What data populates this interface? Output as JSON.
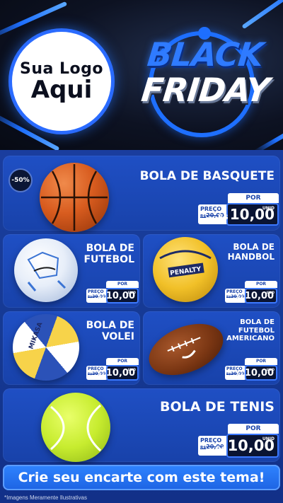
{
  "header": {
    "logo_line1": "Sua Logo",
    "logo_line2": "Aqui",
    "title_line1": "BLACK",
    "title_line2": "FRIDAY"
  },
  "products": [
    {
      "name": "BOLA DE BASQUETE",
      "badge": "-50%",
      "por": "POR",
      "preco_label": "PREÇO",
      "old_currency": "R$",
      "old_value": "20,00",
      "currency": "R$",
      "value": "10,00",
      "unit": "UNID"
    },
    {
      "name_line1": "BOLA DE",
      "name_line2": "FUTEBOL",
      "por": "POR",
      "preco_label": "PREÇO",
      "old_currency": "R$",
      "old_value": "20,00",
      "currency": "R$",
      "value": "10,00",
      "unit": "UNID"
    },
    {
      "name_line1": "BOLA DE",
      "name_line2": "HANDBOL",
      "por": "POR",
      "preco_label": "PREÇO",
      "old_currency": "R$",
      "old_value": "20,00",
      "currency": "R$",
      "value": "10,00",
      "unit": "UNID"
    },
    {
      "name_line1": "BOLA DE",
      "name_line2": "VOLEI",
      "por": "POR",
      "preco_label": "PREÇO",
      "old_currency": "R$",
      "old_value": "20,00",
      "currency": "R$",
      "value": "10,00",
      "unit": "UNID"
    },
    {
      "name_line1": "BOLA DE",
      "name_line2": "FUTEBOL",
      "name_line3": "AMERICANO",
      "por": "POR",
      "preco_label": "PREÇO",
      "old_currency": "R$",
      "old_value": "20,00",
      "currency": "R$",
      "value": "10,00",
      "unit": "UNID"
    },
    {
      "name": "BOLA DE TENIS",
      "por": "POR",
      "preco_label": "PREÇO",
      "old_currency": "R$",
      "old_value": "20,00",
      "currency": "R$",
      "value": "10,00",
      "unit": "UNID"
    }
  ],
  "cta": "Crie seu encarte com este tema!",
  "footnote": "*Imagens Meramente Ilustrativas",
  "colors": {
    "accent": "#1e6fff",
    "card": "#1f4fc4",
    "dark": "#0b0f1e"
  }
}
